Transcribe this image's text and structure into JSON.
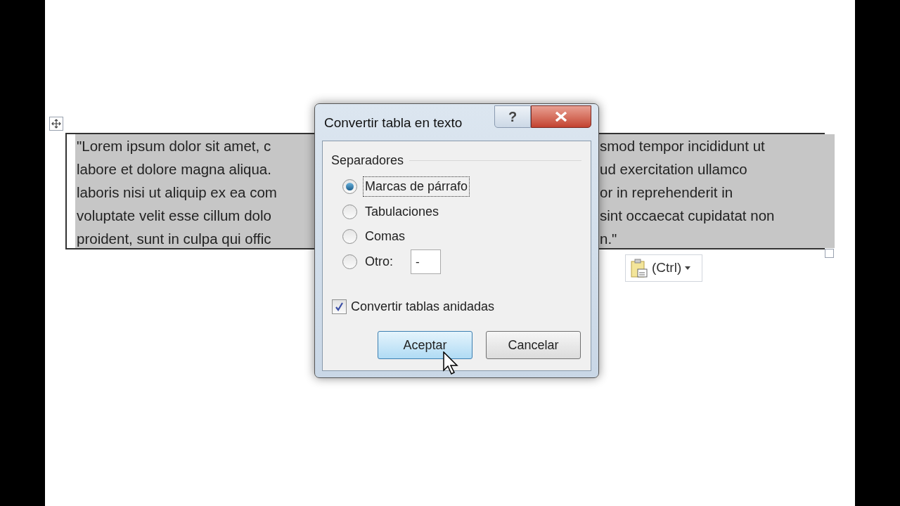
{
  "document": {
    "table_lines": [
      {
        "left": "\"Lorem ipsum dolor sit amet, c",
        "right": "smod tempor incididunt ut"
      },
      {
        "left": "labore et dolore magna aliqua.",
        "right": "ud exercitation ullamco"
      },
      {
        "left": "laboris nisi ut aliquip ex ea com",
        "right": "or in reprehenderit in"
      },
      {
        "left": "voluptate velit esse cillum dolo",
        "right": "sint occaecat cupidatat non"
      },
      {
        "left": "proident, sunt in culpa qui offic",
        "right": "n.\""
      }
    ],
    "selected": true,
    "paste_options": {
      "label": "(Ctrl)"
    }
  },
  "dialog": {
    "title": "Convertir tabla en texto",
    "help": "?",
    "group": "Separadores",
    "options": [
      {
        "label": "Marcas de párrafo",
        "selected": true,
        "focused": true
      },
      {
        "label": "Tabulaciones",
        "selected": false,
        "focused": false
      },
      {
        "label": "Comas",
        "selected": false,
        "focused": false
      },
      {
        "label": "Otro:",
        "selected": false,
        "focused": false
      }
    ],
    "other_separator_field": {
      "value": "-"
    },
    "nested": {
      "label": "Convertir tablas anidadas",
      "checked": true
    },
    "buttons": [
      {
        "label": "Aceptar",
        "kind": "default"
      },
      {
        "label": "Cancelar",
        "kind": "normal"
      }
    ]
  }
}
